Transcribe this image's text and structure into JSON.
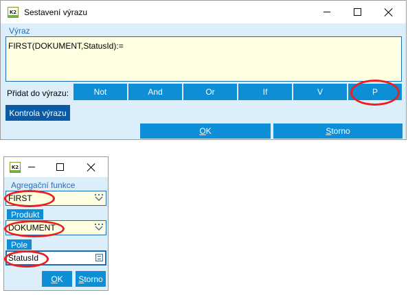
{
  "main_dialog": {
    "title": "Sestavení výrazu",
    "expression_label": "Výraz",
    "expression_value": "FIRST(DOKUMENT,StatusId):=",
    "add_label": "Přidat do výrazu:",
    "operators": [
      "Not",
      "And",
      "Or",
      "If",
      "V",
      "P"
    ],
    "check_button": "Kontrola výrazu",
    "ok_button": "OK",
    "ok_underline": "O",
    "ok_rest": "K",
    "cancel_underline": "S",
    "cancel_rest": "torno"
  },
  "small_dialog": {
    "aggregation_label": "Agregační funkce",
    "aggregation_value": "FIRST",
    "product_tab": "Produkt",
    "product_value": "DOKUMENT",
    "field_tab": "Pole",
    "field_value": "StatusId",
    "ok_underline": "O",
    "ok_rest": "K",
    "cancel_underline": "S",
    "cancel_rest": "torno"
  },
  "icons": {
    "app_icon": "k2-app-icon",
    "app_icon_text": "K2"
  },
  "colors": {
    "dialog_bg": "#dbeefa",
    "button_blue": "#0d8ed7",
    "check_button": "#0a5aa5",
    "input_bg": "#fefee0",
    "annotation_red": "#e8201e"
  }
}
